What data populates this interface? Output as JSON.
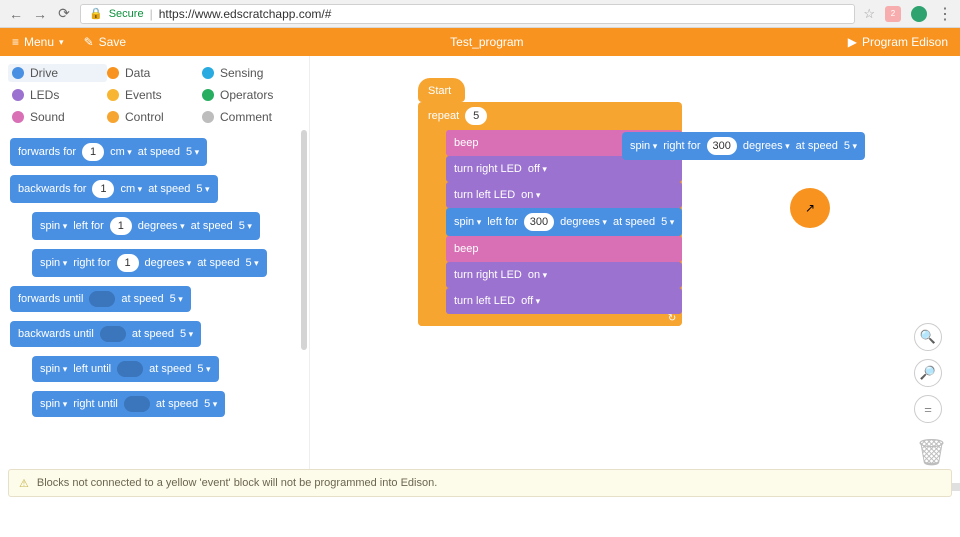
{
  "browser": {
    "secure_label": "Secure",
    "url": "https://www.edscratchapp.com/#",
    "badge": "2"
  },
  "toolbar": {
    "menu": "Menu",
    "save": "Save",
    "title": "Test_program",
    "program": "Program Edison"
  },
  "categories": {
    "drive": "Drive",
    "data": "Data",
    "sensing": "Sensing",
    "leds": "LEDs",
    "events": "Events",
    "operators": "Operators",
    "sound": "Sound",
    "control": "Control",
    "comment": "Comment"
  },
  "colors": {
    "drive": "#4a90e2",
    "data": "#f7931e",
    "sensing": "#29abe2",
    "leds": "#9b72cf",
    "events": "#f7b531",
    "operators": "#27ae60",
    "sound": "#d96fb4",
    "control": "#f7a531",
    "comment": "#bdbdbd"
  },
  "palette": {
    "forwards_for": "forwards for",
    "backwards_for": "backwards for",
    "spin": "spin",
    "left_for": "left for",
    "right_for": "right for",
    "forwards_until": "forwards until",
    "backwards_until": "backwards until",
    "left_until": "left until",
    "right_until": "right until",
    "cm": "cm",
    "degrees": "degrees",
    "at_speed": "at speed",
    "one": "1",
    "five": "5"
  },
  "canvas": {
    "start": "Start",
    "repeat": "repeat",
    "repeat_n": "5",
    "beep": "beep",
    "turn_right_led": "turn right LED",
    "turn_left_led": "turn left LED",
    "on": "on",
    "off": "off",
    "spin": "spin",
    "left_for": "left for",
    "right_for": "right for",
    "val300": "300",
    "degrees": "degrees",
    "at_speed": "at speed",
    "spd5": "5"
  },
  "tools": {
    "zoom_in": "⊕",
    "zoom_out": "⊖",
    "reset": "="
  },
  "warning": "Blocks not connected to a yellow 'event' block will not be programmed into Edison."
}
